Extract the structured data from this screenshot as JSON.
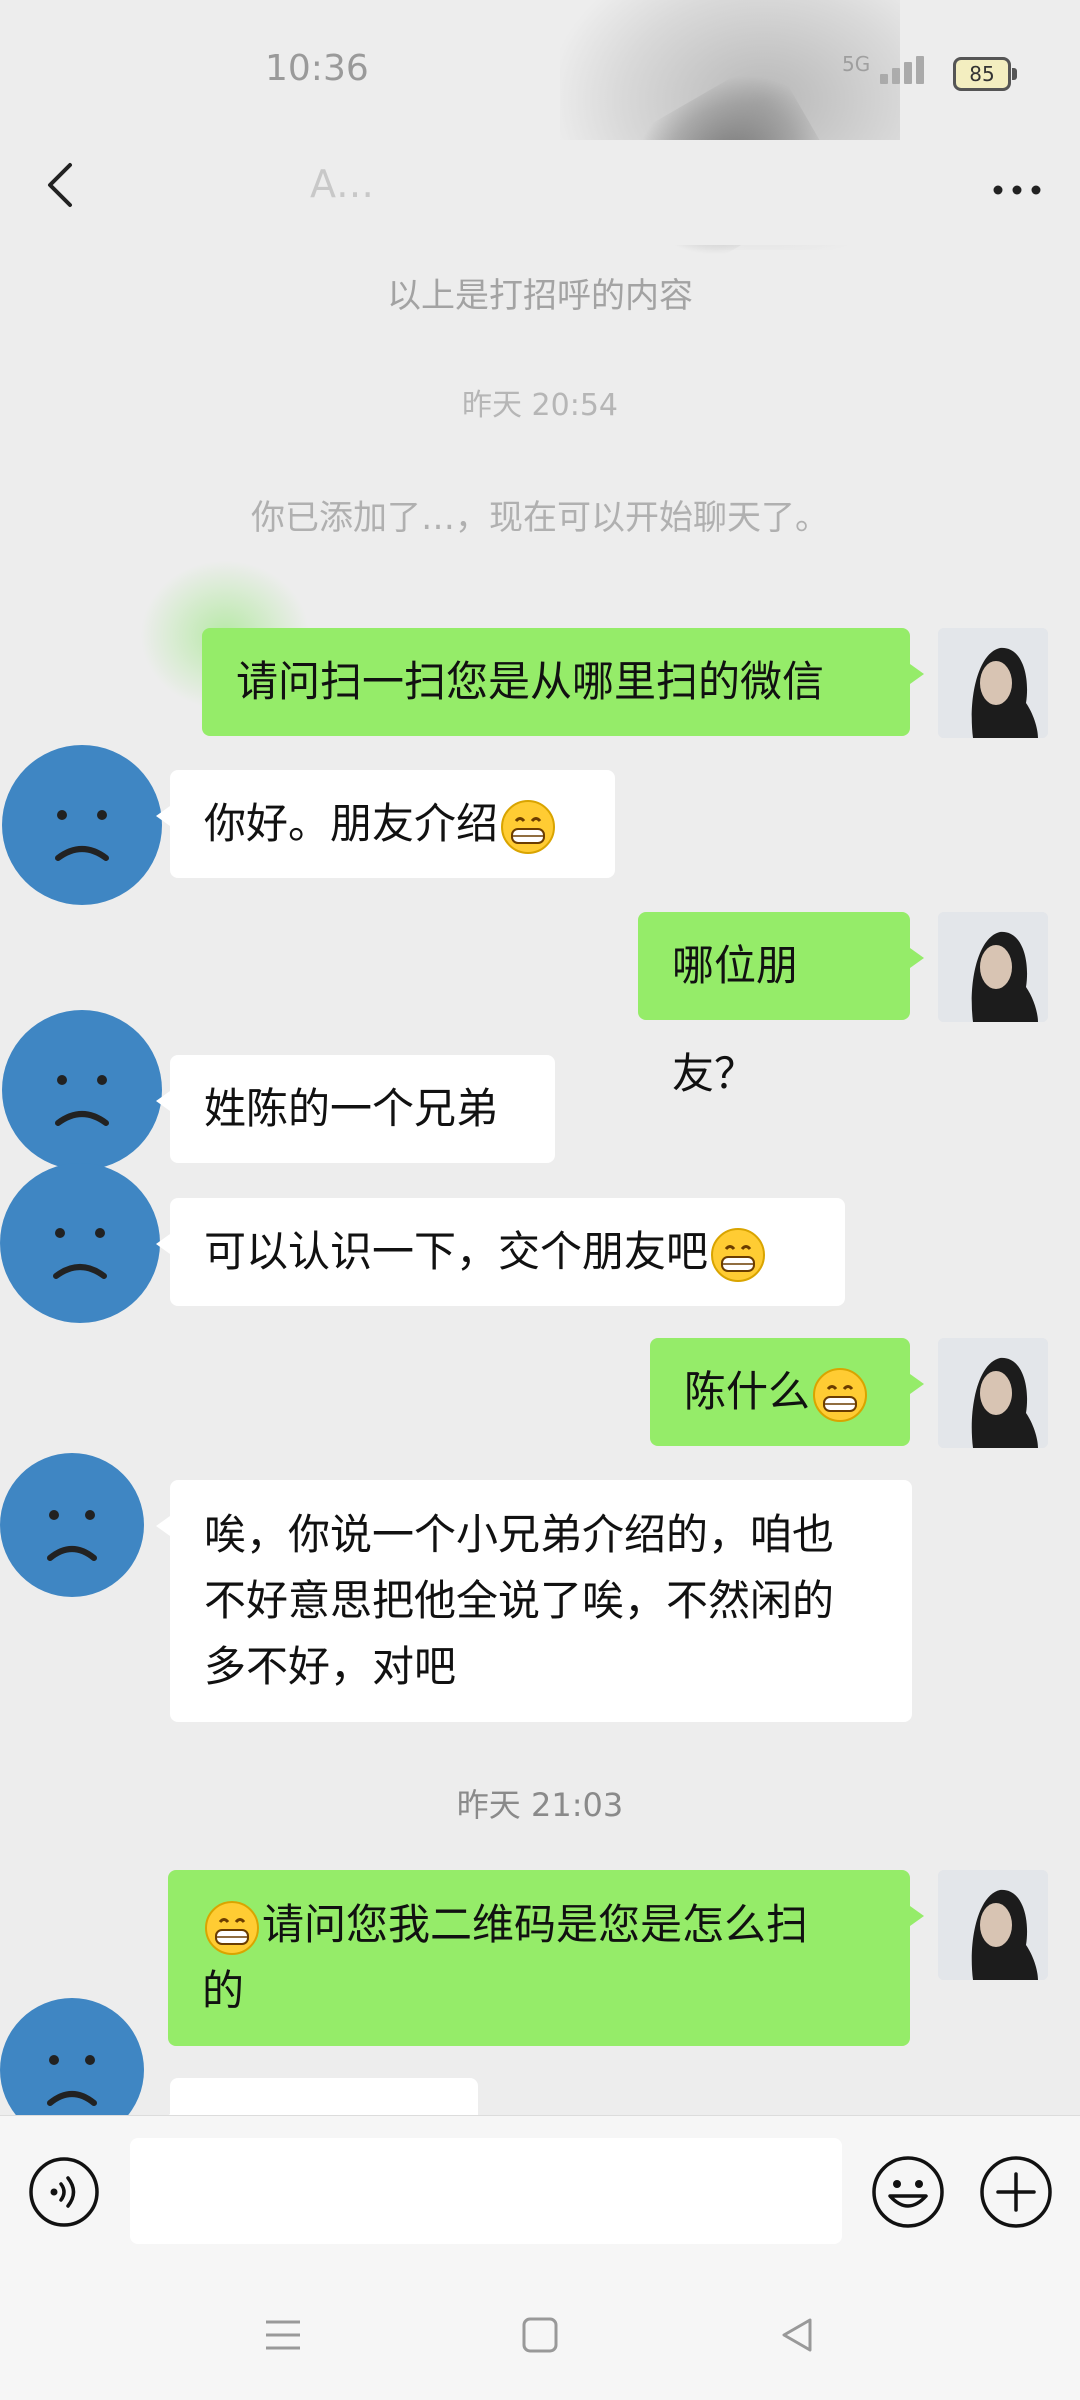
{
  "status_bar": {
    "time": "10:36",
    "network": "5G",
    "battery": "85"
  },
  "header": {
    "title": "A…",
    "more_icon": "more-icon",
    "back_icon": "back-icon"
  },
  "system_messages": {
    "greeting_note": "以上是打招呼的内容",
    "time_added": "昨天 20:54",
    "added_note": "你已添加了…，现在可以开始聊天了。"
  },
  "messages": [
    {
      "side": "me",
      "text": "请问扫一扫您是从哪里扫的微信"
    },
    {
      "side": "other",
      "text": "你好。朋友介绍",
      "emoji": "grin"
    },
    {
      "side": "me",
      "text": "哪位朋友？"
    },
    {
      "side": "other",
      "text": "姓陈的一个兄弟"
    },
    {
      "side": "other",
      "text": "可以认识一下，交个朋友吧",
      "emoji": "grin"
    },
    {
      "side": "me",
      "text": "陈什么",
      "emoji": "grin"
    },
    {
      "side": "other",
      "lines": [
        "唉，你说一个小兄弟介绍的，咱也",
        "不好意思把他全说了唉，不然闲的",
        "多不好，对吧"
      ]
    },
    {
      "side": "me",
      "lines": [
        "请问您我二维码是您是怎么扫",
        "的"
      ],
      "emoji": "grin"
    }
  ],
  "timestamp": "昨天 21:03",
  "input": {
    "voice_icon": "voice-icon",
    "emoji_icon": "emoji-icon",
    "plus_icon": "plus-icon"
  },
  "system_nav": {
    "menu_icon": "menu-icon",
    "home_icon": "home-icon",
    "back_icon": "nav-back-icon"
  },
  "colors": {
    "background": "#ededed",
    "my_bubble": "#95ec69",
    "their_bubble": "#ffffff",
    "avatar_blue": "#3f86c3"
  }
}
